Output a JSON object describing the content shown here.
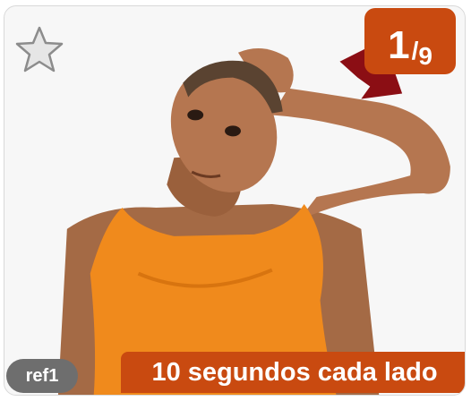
{
  "card": {
    "counter": {
      "current": "1",
      "slash": "/",
      "total": "9"
    },
    "ref_label": "ref1",
    "duration_label": "10 segundos cada lado",
    "favorite_icon": "star-outline-icon",
    "colors": {
      "accent": "#c94a10",
      "badge": "#6e6e6e",
      "shirt": "#f08a1c",
      "arrow": "#8b0e14"
    }
  }
}
